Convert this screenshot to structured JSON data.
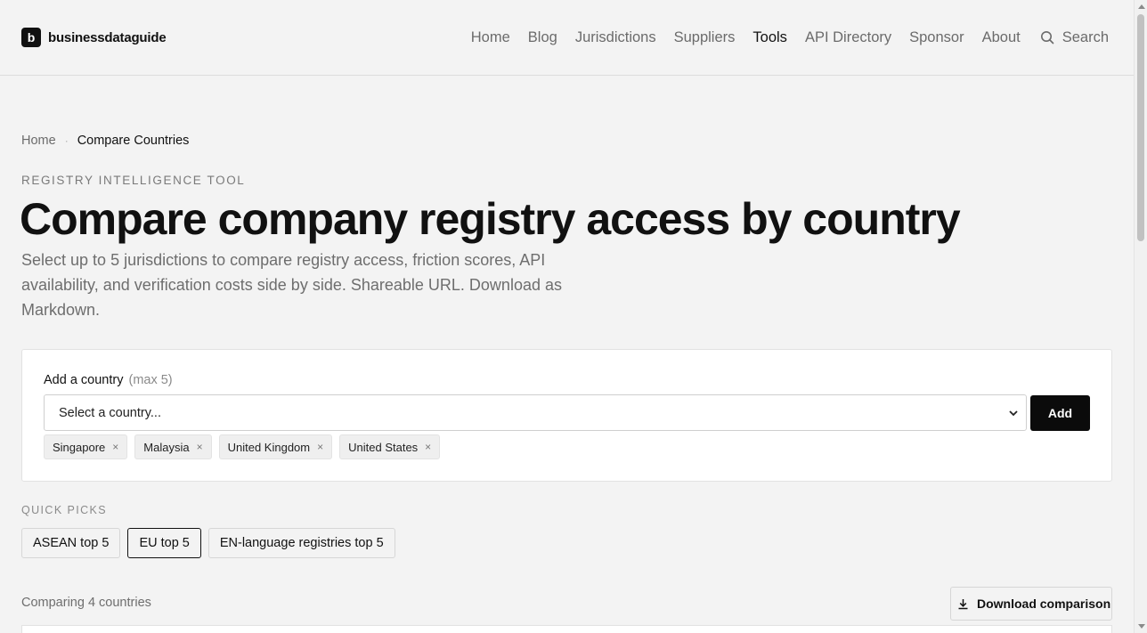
{
  "header": {
    "logo_mark": "b",
    "logo_text": "businessdataguide",
    "nav": [
      {
        "label": "Home"
      },
      {
        "label": "Blog"
      },
      {
        "label": "Jurisdictions"
      },
      {
        "label": "Suppliers"
      },
      {
        "label": "Tools",
        "active": true
      },
      {
        "label": "API Directory"
      },
      {
        "label": "Sponsor"
      },
      {
        "label": "About"
      }
    ],
    "search_label": "Search"
  },
  "breadcrumb": {
    "home": "Home",
    "separator": "·",
    "current": "Compare Countries"
  },
  "eyebrow": "REGISTRY INTELLIGENCE TOOL",
  "title": "Compare company registry access by country",
  "subtitle": "Select up to 5 jurisdictions to compare registry access, friction scores, API availability, and verification costs side by side. Shareable URL. Download as Markdown.",
  "add_country": {
    "label": "Add a country",
    "max_note": "(max 5)",
    "select_value": "Select a country...",
    "add_button": "Add",
    "selected": [
      {
        "label": "Singapore"
      },
      {
        "label": "Malaysia"
      },
      {
        "label": "United Kingdom"
      },
      {
        "label": "United States"
      }
    ],
    "remove_glyph": "×"
  },
  "quick_picks": {
    "label": "QUICK PICKS",
    "options": [
      {
        "label": "ASEAN top 5"
      },
      {
        "label": "EU top 5",
        "active": true
      },
      {
        "label": "EN-language registries top 5"
      }
    ]
  },
  "comparison": {
    "status": "Comparing 4 countries",
    "download_label": "Download comparison"
  }
}
